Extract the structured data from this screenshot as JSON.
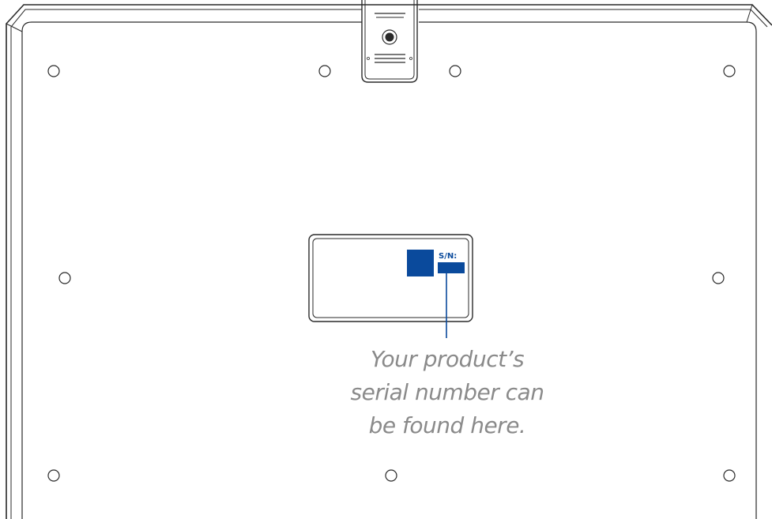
{
  "label": {
    "serial_prefix": "S/N:"
  },
  "caption": {
    "line1": "Your product’s",
    "line2": "serial number can",
    "line3": "be found here."
  },
  "colors": {
    "outline": "#2a2a2a",
    "accent_blue": "#0a4a9c",
    "caption_gray": "#8a8a8a",
    "background": "#ffffff"
  },
  "icons": {
    "screw_holes": "circle-outline",
    "hinge_button": "circle-filled"
  }
}
